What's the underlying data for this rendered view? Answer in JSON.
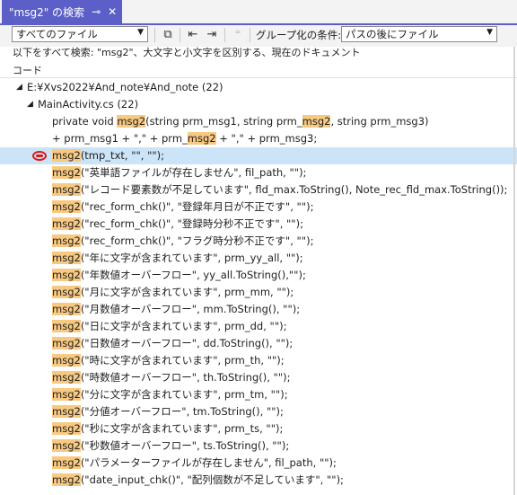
{
  "tab": {
    "title": "\"msg2\" の検索",
    "pin_icon": "pin-icon",
    "close_icon": "close-icon"
  },
  "toolbar": {
    "scope_value": "すべてのファイル",
    "group_label": "グループ化の条件:",
    "group_value": "パスの後にファイル"
  },
  "description": "以下をすべて検索: \"msg2\"、大文字と小文字を区別する、現在のドキュメント",
  "column_header": "コード",
  "tree": {
    "path": {
      "label": "E:¥Xvs2022¥And_note¥And_note (22)"
    },
    "file": {
      "label": "MainActivity.cs (22)"
    }
  },
  "results": [
    {
      "pre": "private void ",
      "hl": "msg2",
      "post": "(string prm_msg1, string prm_",
      "hl2": "msg2",
      "post2": ", string prm_msg3)"
    },
    {
      "pre": "+ prm_msg1 + \",\" + prm_",
      "hl": "msg2",
      "post": " + \",\" + prm_msg3;",
      "hl2": "",
      "post2": ""
    },
    {
      "pre": "",
      "hl": "msg2",
      "post": "(tmp_txt, \"\", \"\");",
      "hl2": "",
      "post2": "",
      "selected": true
    },
    {
      "pre": "",
      "hl": "msg2",
      "post": "(\"英単語ファイルが存在しません\", fil_path, \"\");"
    },
    {
      "pre": "",
      "hl": "msg2",
      "post": "(\"レコード要素数が不足しています\", fld_max.ToString(), Note_rec_fld_max.ToString());"
    },
    {
      "pre": "",
      "hl": "msg2",
      "post": "(\"rec_form_chk()\", \"登録年月日が不正です\", \"\");"
    },
    {
      "pre": "",
      "hl": "msg2",
      "post": "(\"rec_form_chk()\", \"登録時分秒不正です\", \"\");"
    },
    {
      "pre": "",
      "hl": "msg2",
      "post": "(\"rec_form_chk()\", \"フラグ時分秒不正です\", \"\");"
    },
    {
      "pre": "",
      "hl": "msg2",
      "post": "(\"年に文字が含まれています\", prm_yy_all, \"\");"
    },
    {
      "pre": "",
      "hl": "msg2",
      "post": "(\"年数値オーバーフロー\", yy_all.ToString(),\"\");"
    },
    {
      "pre": "",
      "hl": "msg2",
      "post": "(\"月に文字が含まれています\", prm_mm, \"\");"
    },
    {
      "pre": "",
      "hl": "msg2",
      "post": "(\"月数値オーバーフロー\", mm.ToString(), \"\");"
    },
    {
      "pre": "",
      "hl": "msg2",
      "post": "(\"日に文字が含まれています\", prm_dd, \"\");"
    },
    {
      "pre": "",
      "hl": "msg2",
      "post": "(\"日数値オーバーフロー\", dd.ToString(), \"\");"
    },
    {
      "pre": "",
      "hl": "msg2",
      "post": "(\"時に文字が含まれています\", prm_th, \"\");"
    },
    {
      "pre": "",
      "hl": "msg2",
      "post": "(\"時数値オーバーフロー\", th.ToString(), \"\");"
    },
    {
      "pre": "",
      "hl": "msg2",
      "post": "(\"分に文字が含まれています\", prm_tm, \"\");"
    },
    {
      "pre": "",
      "hl": "msg2",
      "post": "(\"分値オーバーフロー\", tm.ToString(), \"\");"
    },
    {
      "pre": "",
      "hl": "msg2",
      "post": "(\"秒に文字が含まれています\", prm_ts, \"\");"
    },
    {
      "pre": "",
      "hl": "msg2",
      "post": "(\"秒数値オーバーフロー\", ts.ToString(), \"\");"
    },
    {
      "pre": "",
      "hl": "msg2",
      "post": "(\"パラメーターファイルが存在しません\", fil_path, \"\");"
    },
    {
      "pre": "",
      "hl": "msg2",
      "post": "(\"date_input_chk()\", \"配列個数が不足しています\", \"\");"
    }
  ],
  "colors": {
    "tab_accent": "#5b5fc7",
    "highlight": "#f8c981",
    "selected_row": "#cce4f7",
    "breakpoint_marker": "#d81919"
  }
}
